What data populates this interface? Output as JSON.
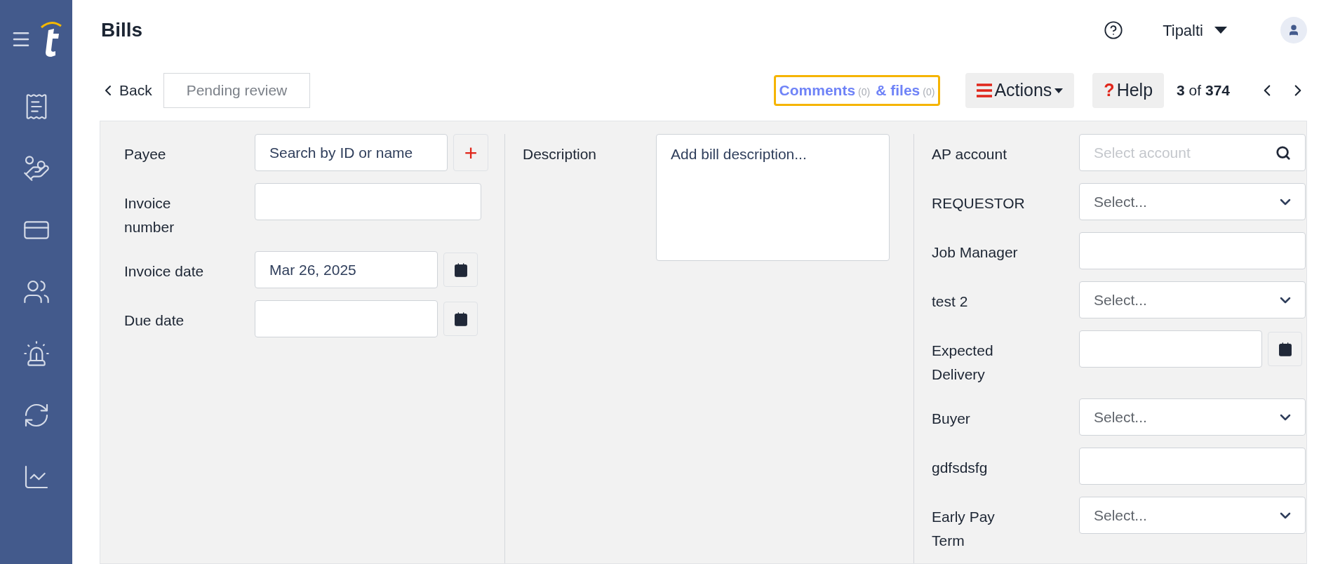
{
  "header": {
    "title": "Bills",
    "user": "Tipalti"
  },
  "toolbar": {
    "back": "Back",
    "status": "Pending review",
    "comments": {
      "label": "Comments",
      "count": "(0)"
    },
    "files": {
      "label": "& files",
      "count": "(0)"
    },
    "actions": "Actions",
    "help_mark": "?",
    "help": "Help",
    "pager": {
      "current": "3",
      "of": "of",
      "total": "374"
    }
  },
  "form": {
    "left": [
      {
        "label": "Payee",
        "kind": "payee",
        "placeholder": "Search by ID or name",
        "add": "+"
      },
      {
        "label": "Invoice number",
        "kind": "text"
      },
      {
        "label": "Invoice date",
        "kind": "date",
        "value": "Mar 26, 2025"
      },
      {
        "label": "Due date",
        "kind": "date"
      }
    ],
    "middle": [
      {
        "label": "Description",
        "kind": "textarea",
        "placeholder": "Add bill description..."
      }
    ],
    "right": [
      {
        "label": "AP account",
        "kind": "search",
        "placeholder": "Select account"
      },
      {
        "label": "REQUESTOR",
        "kind": "select",
        "placeholder": "Select..."
      },
      {
        "label": "Job Manager",
        "kind": "text"
      },
      {
        "label": "test 2",
        "kind": "select",
        "placeholder": "Select..."
      },
      {
        "label": "Expected Delivery",
        "kind": "date"
      },
      {
        "label": "Buyer",
        "kind": "select",
        "placeholder": "Select..."
      },
      {
        "label": "gdfsdsfg",
        "kind": "text"
      },
      {
        "label": "Early Pay Term",
        "kind": "select",
        "placeholder": "Select..."
      }
    ]
  }
}
